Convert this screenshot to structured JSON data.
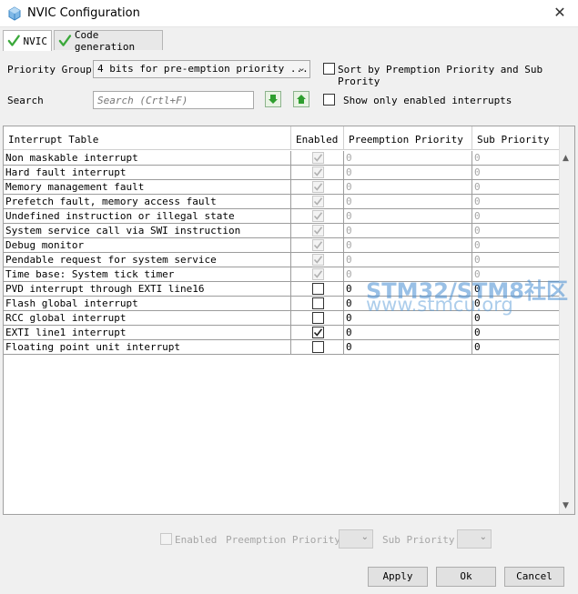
{
  "window": {
    "title": "NVIC Configuration",
    "close_glyph": "✕"
  },
  "tabs": [
    {
      "label": "NVIC",
      "icon": "check-icon"
    },
    {
      "label": "Code generation",
      "icon": "check-icon"
    }
  ],
  "priority_group": {
    "label": "Priority Group",
    "value": "4 bits for pre-emption priority ..."
  },
  "sort_option": {
    "label": "Sort by Premption Priority and Sub Prority",
    "checked": false
  },
  "search": {
    "label": "Search",
    "placeholder": "Search (Crtl+F)",
    "value": ""
  },
  "show_enabled_option": {
    "label": "Show only enabled interrupts",
    "checked": false
  },
  "table": {
    "headers": [
      "Interrupt Table",
      "Enabled",
      "Preemption Priority",
      "Sub Priority"
    ],
    "rows": [
      {
        "name": "Non maskable interrupt",
        "enabled": true,
        "locked": true,
        "preemption": "0",
        "sub": "0"
      },
      {
        "name": "Hard fault interrupt",
        "enabled": true,
        "locked": true,
        "preemption": "0",
        "sub": "0"
      },
      {
        "name": "Memory management fault",
        "enabled": true,
        "locked": true,
        "preemption": "0",
        "sub": "0"
      },
      {
        "name": "Prefetch fault, memory access fault",
        "enabled": true,
        "locked": true,
        "preemption": "0",
        "sub": "0"
      },
      {
        "name": "Undefined instruction or illegal state",
        "enabled": true,
        "locked": true,
        "preemption": "0",
        "sub": "0"
      },
      {
        "name": "System service call via SWI instruction",
        "enabled": true,
        "locked": true,
        "preemption": "0",
        "sub": "0"
      },
      {
        "name": "Debug monitor",
        "enabled": true,
        "locked": true,
        "preemption": "0",
        "sub": "0"
      },
      {
        "name": "Pendable request for system service",
        "enabled": true,
        "locked": true,
        "preemption": "0",
        "sub": "0"
      },
      {
        "name": "Time base: System tick timer",
        "enabled": true,
        "locked": true,
        "preemption": "0",
        "sub": "0"
      },
      {
        "name": "PVD interrupt through EXTI line16",
        "enabled": false,
        "locked": false,
        "preemption": "0",
        "sub": "0"
      },
      {
        "name": "Flash global interrupt",
        "enabled": false,
        "locked": false,
        "preemption": "0",
        "sub": "0"
      },
      {
        "name": "RCC global interrupt",
        "enabled": false,
        "locked": false,
        "preemption": "0",
        "sub": "0"
      },
      {
        "name": "EXTI line1 interrupt",
        "enabled": true,
        "locked": false,
        "preemption": "0",
        "sub": "0"
      },
      {
        "name": "Floating point unit interrupt",
        "enabled": false,
        "locked": false,
        "preemption": "0",
        "sub": "0"
      }
    ]
  },
  "watermark": {
    "line1": "STM32/STM8社区",
    "line2": "www.stmcu.org"
  },
  "bottom": {
    "enabled_label": "Enabled",
    "preemption_label": "Preemption Priority",
    "sub_label": "Sub Priority"
  },
  "buttons": {
    "apply": "Apply",
    "ok": "Ok",
    "cancel": "Cancel"
  },
  "colors": {
    "check_green": "#3aa83a",
    "arrow_green": "#2e9e2e"
  }
}
